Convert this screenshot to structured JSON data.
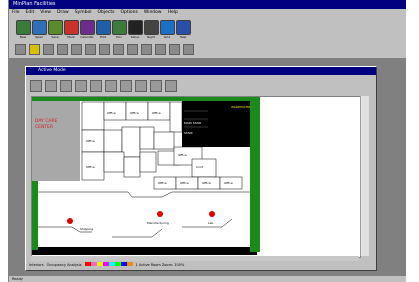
{
  "app": {
    "title": "MinPlan Facilities",
    "menu": [
      "File",
      "Edit",
      "View",
      "Draw",
      "Symbol",
      "Objects",
      "Options",
      "Window",
      "Help"
    ],
    "statusbar": "Ready"
  },
  "main_toolbar": {
    "tools": [
      {
        "icon": "new-document-icon",
        "color": "#3a7a3a",
        "label": "New"
      },
      {
        "icon": "open-folder-icon",
        "color": "#2e6fb8",
        "label": "Open"
      },
      {
        "icon": "save-icon",
        "color": "#5a8a2e",
        "label": "Save"
      },
      {
        "icon": "bookmark-icon",
        "color": "#c9312c",
        "label": "Mark"
      },
      {
        "icon": "calendar-icon",
        "color": "#6d2b8c",
        "label": "Calendar"
      },
      {
        "icon": "pencil-icon",
        "color": "#1e5fa8",
        "label": "Edit"
      },
      {
        "icon": "document-icon",
        "color": "#3d7a3d",
        "label": "Doc"
      },
      {
        "icon": "gear-icon",
        "color": "#222222",
        "label": "Setup"
      },
      {
        "icon": "moon-icon",
        "color": "#444444",
        "label": "Night"
      },
      {
        "icon": "grid-icon",
        "color": "#1c6fc4",
        "label": "Grid"
      },
      {
        "icon": "help-icon",
        "color": "#2a4fa8",
        "label": "Help"
      }
    ]
  },
  "secondary_toolbar": {
    "buttons": [
      "print-icon",
      "view-icon",
      "disk-icon",
      "page-icon",
      "folder-icon",
      "cut-icon",
      "copy-icon",
      "first-icon",
      "prev-icon",
      "next-icon",
      "last-icon",
      "zoom-in-icon",
      "zoom-out-icon"
    ]
  },
  "child_window": {
    "title": "Active Mode",
    "tools": [
      "new-icon",
      "open-icon",
      "save-icon",
      "undo-icon",
      "redo-icon",
      "check-icon",
      "measure-icon",
      "zoom-icon",
      "pan-icon",
      "print-icon"
    ],
    "floorplan": {
      "labels": {
        "daycare": [
          "DAY CARE",
          "CENTER"
        ],
        "elevator": "ELEVATOR",
        "stair1": "MAIN STAIR",
        "stair2": "STAIR",
        "warehouse": "WAREHOUSE",
        "room_office": "Office",
        "room_conf": "Conf",
        "shipping": "Shipping",
        "manufacturing": "Manufacturing",
        "lab": "Lab"
      }
    },
    "status": {
      "left": "Interiors",
      "mid": "Occupancy Analysis",
      "right": "1 Active Room  Zoom: 100%",
      "swatches": [
        "#ff0000",
        "#ff66cc",
        "#ffff00",
        "#ff00ff",
        "#00ffff",
        "#00ff00",
        "#0000ff",
        "#ff8800"
      ]
    }
  }
}
